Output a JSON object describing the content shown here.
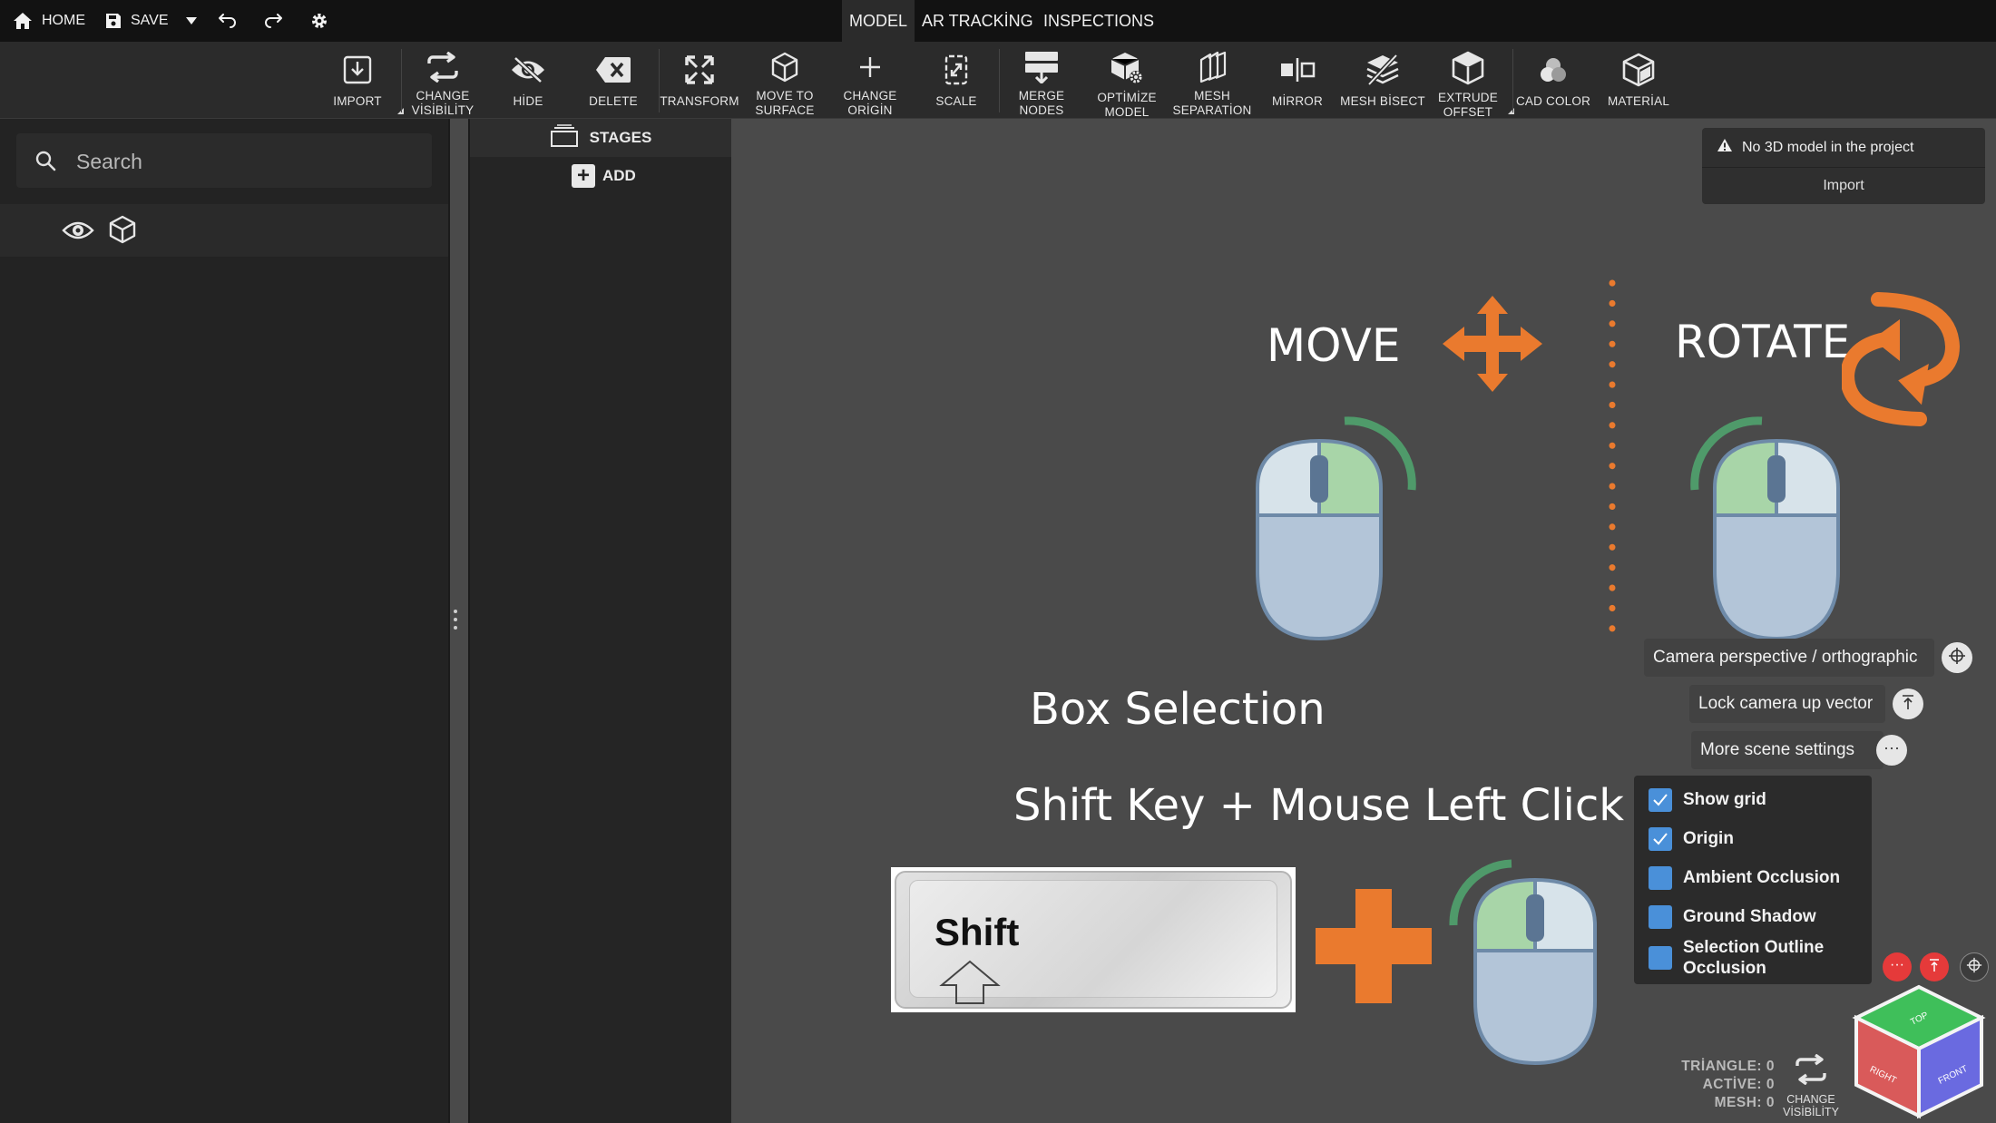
{
  "topbar": {
    "home_label": "HOME",
    "save_label": "SAVE",
    "tabs": [
      "MODEL",
      "AR TRACKİNG",
      "INSPECTIONS"
    ]
  },
  "toolbar": {
    "tools": [
      {
        "l1": "IMPORT",
        "l2": ""
      },
      {
        "l1": "CHANGE",
        "l2": "VİSİBİLİTY"
      },
      {
        "l1": "HİDE",
        "l2": ""
      },
      {
        "l1": "DELETE",
        "l2": ""
      },
      {
        "l1": "TRANSFORM",
        "l2": ""
      },
      {
        "l1": "MOVE TO",
        "l2": "SURFACE"
      },
      {
        "l1": "CHANGE",
        "l2": "ORİGİN"
      },
      {
        "l1": "SCALE",
        "l2": ""
      },
      {
        "l1": "MERGE",
        "l2": "NODES"
      },
      {
        "l1": "OPTİMİZE",
        "l2": "MODEL"
      },
      {
        "l1": "MESH",
        "l2": "SEPARATİON"
      },
      {
        "l1": "MİRROR",
        "l2": ""
      },
      {
        "l1": "MESH BİSECT",
        "l2": ""
      },
      {
        "l1": "EXTRUDE",
        "l2": "OFFSET"
      },
      {
        "l1": "CAD COLOR",
        "l2": ""
      },
      {
        "l1": "MATERİAL",
        "l2": ""
      }
    ]
  },
  "left_panel": {
    "search_placeholder": "Search"
  },
  "stages": {
    "title": "STAGES",
    "add_label": "ADD"
  },
  "viewport": {
    "move_label": "MOVE",
    "rotate_label": "ROTATE",
    "box_selection_title": "Box Selection",
    "box_selection_hint": "Shift Key + Mouse Left Click",
    "shift_key_label": "Shift"
  },
  "notice": {
    "message": "No 3D model in the project",
    "import_label": "Import"
  },
  "camera": {
    "perspective_label": "Camera perspective / orthographic",
    "lock_label": "Lock camera up vector",
    "more_label": "More scene settings"
  },
  "scene_settings": [
    {
      "label": "Show grid",
      "checked": true
    },
    {
      "label": "Origin",
      "checked": true
    },
    {
      "label": "Ambient Occlusion",
      "checked": false
    },
    {
      "label": "Ground Shadow",
      "checked": false
    },
    {
      "label": "Selection Outline",
      "label2": "Occlusion",
      "checked": false
    }
  ],
  "stats": {
    "triangle": "TRİANGLE: 0",
    "active": "ACTİVE: 0",
    "mesh": "MESH: 0",
    "change_visibility_l1": "CHANGE",
    "change_visibility_l2": "VİSİBİLİTY"
  },
  "nav_cube": {
    "top": "TOP",
    "right": "RIGHT",
    "front": "FRONT"
  },
  "colors": {
    "accent_orange": "#ea7a2e",
    "mouse_green": "#a8d5a8",
    "checkbox_blue": "#4a90d9"
  }
}
